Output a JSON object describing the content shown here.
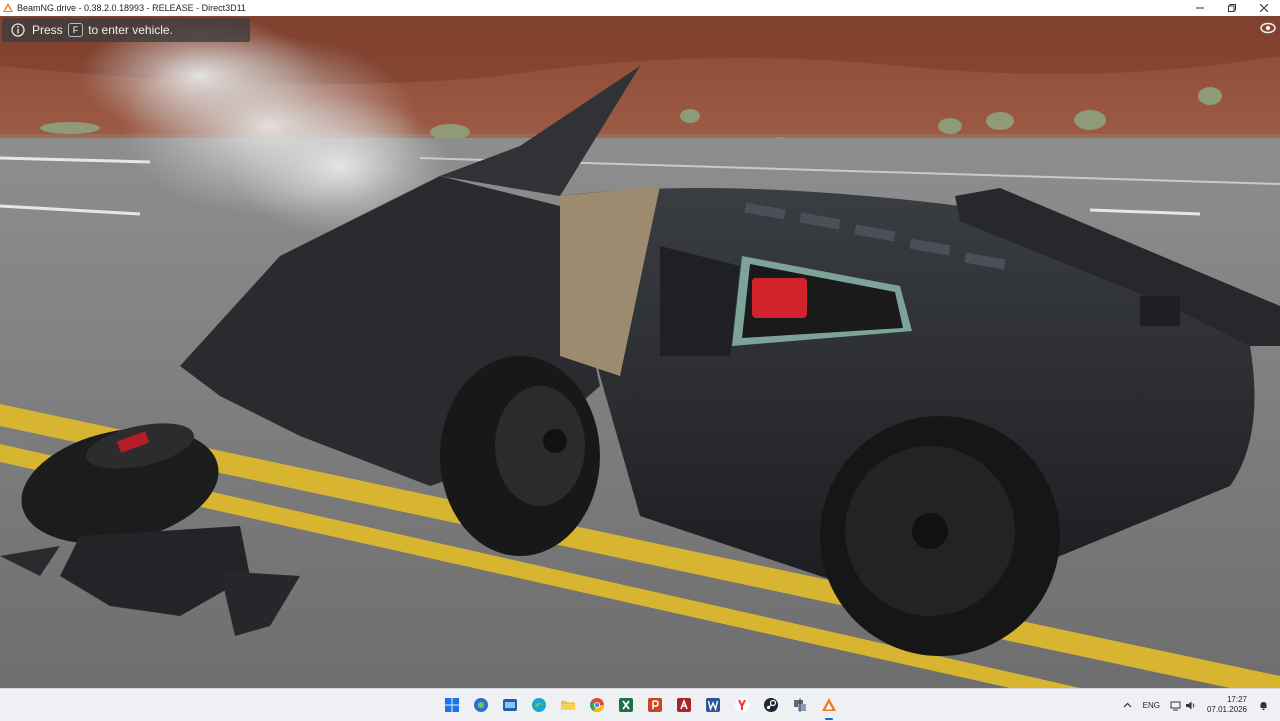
{
  "window": {
    "title": "BeamNG.drive - 0.38.2.0.18993 - RELEASE - Direct3D11",
    "controls": [
      "minimize",
      "maximize",
      "close"
    ]
  },
  "game": {
    "notice": {
      "prefix": "Press",
      "key": "F",
      "suffix": "to enter vehicle."
    },
    "icons": {
      "info": "info-icon",
      "visibility": "eye-icon"
    }
  },
  "taskbar": {
    "apps": [
      {
        "name": "start-button",
        "color": "#1a73e8"
      },
      {
        "name": "app-icon",
        "color": "#2c6fd1"
      },
      {
        "name": "app-icon",
        "color": "#1f5fa9"
      },
      {
        "name": "edge-icon",
        "color": "#1aa7c9"
      },
      {
        "name": "file-explorer-icon",
        "color": "#f2c230"
      },
      {
        "name": "chrome-icon",
        "color": "#e8453c"
      },
      {
        "name": "excel-icon",
        "color": "#1e7145"
      },
      {
        "name": "powerpoint-icon",
        "color": "#d04423"
      },
      {
        "name": "access-icon",
        "color": "#a4262c"
      },
      {
        "name": "word-icon",
        "color": "#2b579a"
      },
      {
        "name": "yandex-browser-icon",
        "color": "#ff3333"
      },
      {
        "name": "steam-icon",
        "color": "#1b2838"
      },
      {
        "name": "app-icon",
        "color": "#5a6b7b"
      },
      {
        "name": "beamng-icon",
        "color": "#f07a19"
      }
    ],
    "tray": {
      "language": "ENG",
      "time": "17:27",
      "date": "07.01.2026"
    }
  }
}
